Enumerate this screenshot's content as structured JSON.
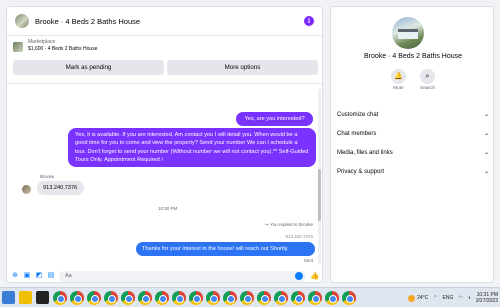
{
  "chat": {
    "title": "Brooke · 4 Beds 2 Baths House",
    "info_icon": "i",
    "listing": {
      "label": "Marketplace",
      "price_line": "$1,600 · 4 Beds 2 Baths House",
      "mark_pending": "Mark as pending",
      "more_options": "More options"
    },
    "messages": {
      "q1": "Yes, are you interested?",
      "long": "Yes, it is available. If you are interested,  Am contact you I will detail you.  When would be a good time for you to come and view the property? Send your number We can I schedule a tour.  Don't forget to send your number (Without number we will not contact you).** Self-Guided Tours Only. Appointment Required /",
      "sender": "Brooke",
      "phone": "913.240.7376",
      "time": "10:30 PM",
      "replied": "You replied to Brooke",
      "quoted_phone": "913.240.7376",
      "reply": "Thanks for your interest in the house! will reach out Shortly.",
      "sent": "Sent"
    },
    "composer": {
      "placeholder": "Aa",
      "like": "👍"
    }
  },
  "side": {
    "name": "Brooke · 4 Beds 2 Baths House",
    "actions": [
      {
        "label": "Mute",
        "icon": "bell-icon"
      },
      {
        "label": "Search",
        "icon": "search-icon"
      }
    ],
    "menu": [
      "Customize chat",
      "Chat members",
      "Media, files and links",
      "Privacy & support"
    ]
  },
  "taskbar": {
    "weather": "24°C",
    "lang": "ENG",
    "time": "10:31 PM",
    "date": "3/27/2023"
  },
  "colors": {
    "purple": "#7a33ff",
    "blue": "#2d74f4",
    "accent": "#0a7cff"
  }
}
